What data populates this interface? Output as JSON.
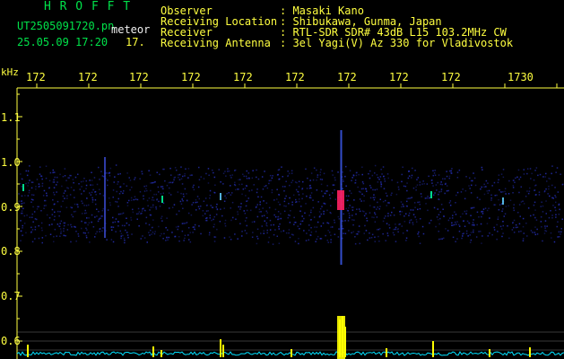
{
  "app": {
    "title": "H R O F F T"
  },
  "capture": {
    "filename": "UT2505091720.pn",
    "category": "meteor",
    "datetime": "25.05.09 17:20",
    "count": "17."
  },
  "info": [
    {
      "label": "Observer",
      "value": ": Masaki Kano"
    },
    {
      "label": "Receiving Location",
      "value": ": Shibukawa, Gunma, Japan"
    },
    {
      "label": "Receiver",
      "value": ": RTL-SDR SDR# 43dB L15 103.2MHz CW"
    },
    {
      "label": "Receiving Antenna",
      "value": ": 3el Yagi(V) Az 330 for Vladivostok"
    }
  ],
  "freq_axis": {
    "unit": "kHz",
    "labels": [
      "172",
      "172",
      "172",
      "172",
      "172",
      "172",
      "172",
      "172",
      "172",
      "1730"
    ]
  },
  "y_axis": {
    "labels": [
      "1.1",
      "1.0",
      "0.9",
      "0.8",
      "0.7",
      "0.6"
    ]
  },
  "colors": {
    "background": "#000000",
    "title_green": "#00e24a",
    "axis_yellow": "#ffff40",
    "label_white": "#f0f0f0",
    "noise_blue": "#2630b8",
    "echo_red": "#ff2060",
    "spectrum_yellow": "#ffff00",
    "spectrum_cyan": "#00e0ff"
  }
}
